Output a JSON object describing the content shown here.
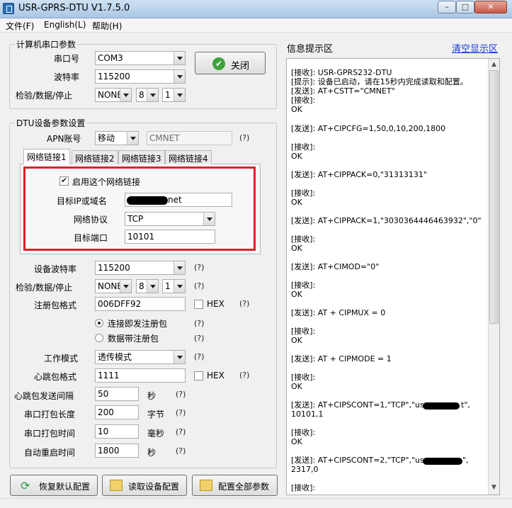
{
  "window": {
    "title": "USR-GPRS-DTU V1.7.5.0"
  },
  "menu": {
    "file": "文件(F)",
    "language": "English(L)",
    "help": "帮助(H)"
  },
  "serial": {
    "group_title": "计算机串口参数",
    "port_label": "串口号",
    "port_value": "COM3",
    "baud_label": "波特率",
    "baud_value": "115200",
    "cds_label": "检验/数据/停止",
    "parity": "NONE",
    "data_bits": "8",
    "stop_bits": "1",
    "close_button": "关闭"
  },
  "dtu": {
    "group_title": "DTU设备参数设置",
    "apn_label": "APN账号",
    "apn_value": "移动",
    "apn_name": "CMNET",
    "hint": "(?)",
    "tabs": [
      "网络链接1",
      "网络链接2",
      "网络链接3",
      "网络链接4"
    ],
    "link": {
      "enable_label": "启用这个网络链接",
      "target_label": "目标IP或域名",
      "target_value": "net",
      "protocol_label": "网络协议",
      "protocol_value": "TCP",
      "port_label": "目标端口",
      "port_value": "10101"
    },
    "device_baud_label": "设备波特率",
    "device_baud_value": "115200",
    "cds_label": "检验/数据/停止",
    "parity": "NONE",
    "data_bits": "8",
    "stop_bits": "1",
    "reg_label": "注册包格式",
    "reg_value": "006DFF92",
    "hex_label": "HEX",
    "reg_opt1": "连接即发注册包",
    "reg_opt2": "数据带注册包",
    "work_mode_label": "工作模式",
    "work_mode_value": "透传模式",
    "heartbeat_label": "心跳包格式",
    "heartbeat_value": "1111",
    "hb_interval_label": "心跳包发送间隔",
    "hb_interval_value": "50",
    "unit_sec": "秒",
    "pack_len_label": "串口打包长度",
    "pack_len_value": "200",
    "unit_byte": "字节",
    "pack_time_label": "串口打包时间",
    "pack_time_value": "10",
    "unit_ms": "毫秒",
    "restart_label": "自动重启时间",
    "restart_value": "1800",
    "unit_sec2": "秒"
  },
  "buttons": {
    "restore": "恢复默认配置",
    "read": "读取设备配置",
    "configure": "配置全部参数"
  },
  "log": {
    "title": "信息提示区",
    "clear": "清空显示区",
    "lines": [
      "[接收]: USR-GPRS232-DTU",
      "[提示]: 设备已启动，请在15秒内完成读取和配置。",
      "[发送]: AT+CSTT=\"CMNET\"",
      "[接收]:",
      "OK",
      "[发送]: AT+CIPCFG=1,50,0,10,200,1800",
      "[接收]:",
      "OK",
      "[发送]: AT+CIPPACK=0,\"31313131\"",
      "[接收]:",
      "OK",
      "[发送]: AT+CIPPACK=1,\"3030364446463932\",\"0\"",
      "[接收]:",
      "OK",
      "[发送]: AT+CIMOD=\"0\"",
      "[接收]:",
      "OK",
      "[发送]: AT + CIPMUX = 0",
      "[接收]:",
      "OK",
      "[发送]: AT + CIPMODE = 1",
      "[接收]:",
      "OK",
      "[发送]: AT+CIPSCONT=1,\"TCP\",\"us",
      "t\",",
      "10101,1",
      "[接收]:",
      "OK",
      "[发送]: AT+CIPSCONT=2,\"TCP\",\"us",
      "\",",
      "2317,0",
      "[接收]:"
    ]
  }
}
